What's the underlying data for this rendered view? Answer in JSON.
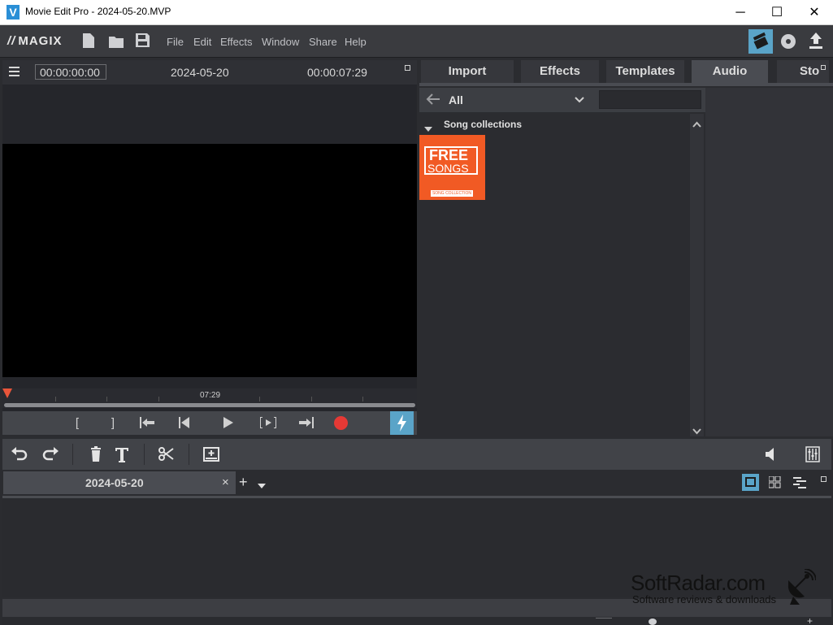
{
  "window": {
    "title": "Movie Edit Pro - 2024-05-20.MVP",
    "app_icon_letter": "V",
    "minimize": "─",
    "maximize": "☐",
    "close": "✕"
  },
  "menubar": {
    "logo": "MAGIX",
    "items": [
      "File",
      "Edit",
      "Effects",
      "Window",
      "Share",
      "Help"
    ]
  },
  "preview": {
    "timecode_current": "00:00:00:00",
    "project_date": "2024-05-20",
    "timecode_total": "00:00:07:29",
    "ruler_label": "07:29"
  },
  "media_pool": {
    "tabs": [
      "Import",
      "Effects",
      "Templates",
      "Audio",
      "Sto"
    ],
    "active_tab": "Audio",
    "browse_label": "All",
    "section_label": "Song collections",
    "thumbnail": {
      "line1": "FREE",
      "line2": "SONGS",
      "badge": "SONG COLLECTION"
    }
  },
  "timeline": {
    "project_tab": "2024-05-20",
    "close_tab": "×",
    "add_tab": "+"
  },
  "watermark": {
    "title": "SoftRadar.com",
    "subtitle": "Software reviews & downloads"
  },
  "colors": {
    "accent": "#5aa4c8",
    "record": "#e53935",
    "thumbnail": "#f15a24",
    "playhead": "#e8553a"
  }
}
